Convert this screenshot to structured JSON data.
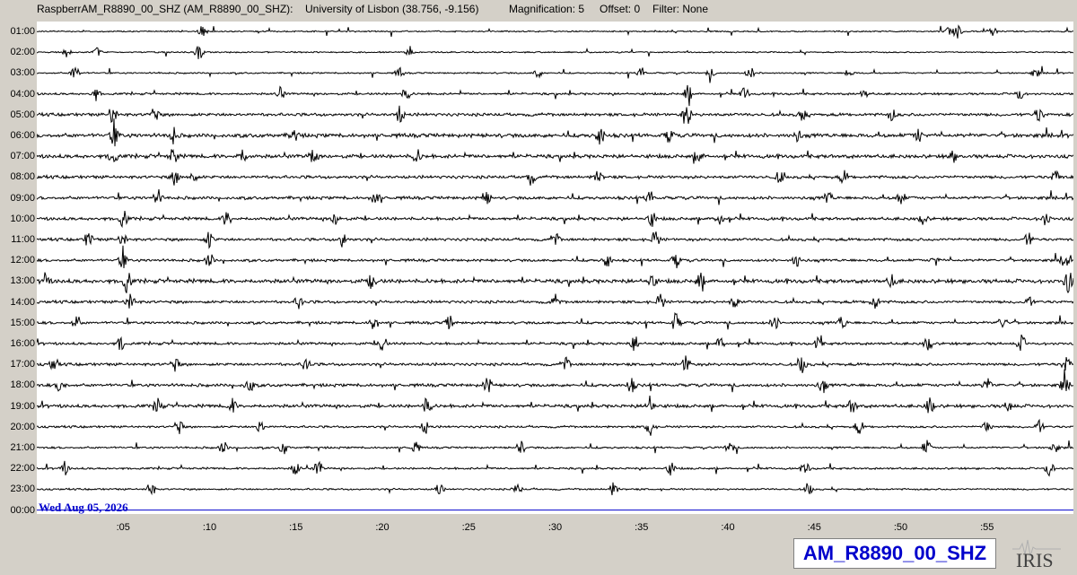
{
  "header": {
    "station": "RaspberrAM_R8890_00_SHZ (AM_R8890_00_SHZ):",
    "location": "University of Lisbon (38.756, -9.156)",
    "magnification": "Magnification: 5",
    "offset": "Offset: 0",
    "filter": "Filter: None"
  },
  "date_label": "Wed Aug 05, 2026",
  "station_box": "AM_R8890_00_SHZ",
  "logo_text": "IRIS",
  "colors": {
    "background": "#d4d0c8",
    "plot_background": "#ffffff",
    "trace": "#000000",
    "date_line": "#0000cc",
    "date_text": "#0000cc",
    "station_text": "#0000cc"
  },
  "chart_data": {
    "type": "line",
    "title": "",
    "xlabel": "",
    "ylabel": "",
    "hours": [
      "01:00",
      "02:00",
      "03:00",
      "04:00",
      "05:00",
      "06:00",
      "07:00",
      "08:00",
      "09:00",
      "10:00",
      "11:00",
      "12:00",
      "13:00",
      "14:00",
      "15:00",
      "16:00",
      "17:00",
      "18:00",
      "19:00",
      "20:00",
      "21:00",
      "22:00",
      "23:00",
      "00:00"
    ],
    "minute_ticks": [
      ":05",
      ":10",
      ":15",
      ":20",
      ":25",
      ":30",
      ":35",
      ":40",
      ":45",
      ":50",
      ":55"
    ],
    "xlim": [
      0,
      60
    ],
    "series_note_amplitude": [
      0.6,
      0.6,
      0.7,
      1.0,
      1.4,
      1.8,
      1.7,
      1.4,
      1.4,
      1.4,
      1.3,
      1.2,
      1.8,
      1.3,
      1.2,
      1.2,
      1.3,
      1.4,
      1.5,
      1.0,
      0.9,
      0.9,
      0.8,
      0
    ],
    "bursts": [
      [
        [
          53.3,
          8
        ],
        [
          55.3,
          6
        ],
        [
          9.6,
          7
        ],
        [
          52.8,
          5
        ]
      ],
      [
        [
          9.4,
          9
        ],
        [
          1.7,
          5
        ],
        [
          3.5,
          5
        ],
        [
          21.6,
          4
        ]
      ],
      [
        [
          2.2,
          10
        ],
        [
          29.0,
          6
        ],
        [
          35.0,
          7
        ],
        [
          41.3,
          8
        ],
        [
          57.8,
          5
        ],
        [
          39.0,
          5
        ],
        [
          21.0,
          6
        ],
        [
          47.0,
          5
        ]
      ],
      [
        [
          3.4,
          8
        ],
        [
          14.1,
          7
        ],
        [
          21.4,
          7
        ],
        [
          37.7,
          10
        ],
        [
          41.0,
          9
        ],
        [
          47.9,
          5
        ],
        [
          56.9,
          7
        ]
      ],
      [
        [
          4.4,
          12
        ],
        [
          6.8,
          9
        ],
        [
          21.0,
          10
        ],
        [
          37.6,
          14
        ],
        [
          44.3,
          9
        ],
        [
          49.5,
          7
        ],
        [
          58.0,
          9
        ]
      ],
      [
        [
          4.5,
          14
        ],
        [
          7.9,
          9
        ],
        [
          14.9,
          8
        ],
        [
          32.6,
          12
        ],
        [
          36.6,
          8
        ],
        [
          44.0,
          7
        ],
        [
          51.0,
          8
        ]
      ],
      [
        [
          4.4,
          10
        ],
        [
          7.9,
          10
        ],
        [
          11.9,
          8
        ],
        [
          16.0,
          9
        ],
        [
          22.0,
          8
        ],
        [
          38.3,
          8
        ],
        [
          53.0,
          7
        ]
      ],
      [
        [
          8.0,
          9
        ],
        [
          9.0,
          8
        ],
        [
          28.6,
          9
        ],
        [
          32.5,
          8
        ],
        [
          43.0,
          7
        ],
        [
          46.7,
          8
        ],
        [
          59.0,
          9
        ]
      ],
      [
        [
          7.0,
          10
        ],
        [
          19.6,
          9
        ],
        [
          26.0,
          9
        ],
        [
          35.5,
          8
        ],
        [
          45.8,
          8
        ],
        [
          50.0,
          9
        ]
      ],
      [
        [
          5.0,
          10
        ],
        [
          11.0,
          9
        ],
        [
          17.3,
          8
        ],
        [
          35.6,
          9
        ],
        [
          39.5,
          8
        ],
        [
          51.3,
          7
        ],
        [
          58.4,
          9
        ]
      ],
      [
        [
          3.0,
          9
        ],
        [
          5.0,
          8
        ],
        [
          10.0,
          11
        ],
        [
          17.7,
          10
        ],
        [
          30.0,
          8
        ],
        [
          35.8,
          10
        ],
        [
          57.4,
          8
        ]
      ],
      [
        [
          5.0,
          11
        ],
        [
          10.0,
          9
        ],
        [
          33.0,
          10
        ],
        [
          37.0,
          9
        ],
        [
          44.0,
          8
        ],
        [
          52.0,
          7
        ],
        [
          59.5,
          9
        ]
      ],
      [
        [
          0.5,
          10
        ],
        [
          5.2,
          13
        ],
        [
          19.4,
          9
        ],
        [
          35.6,
          8
        ],
        [
          38.4,
          9
        ],
        [
          49.5,
          7
        ],
        [
          59.7,
          14
        ]
      ],
      [
        [
          5.4,
          12
        ],
        [
          15.2,
          9
        ],
        [
          30.0,
          8
        ],
        [
          36.1,
          9
        ],
        [
          40.4,
          8
        ],
        [
          48.5,
          8
        ],
        [
          57.4,
          7
        ]
      ],
      [
        [
          2.3,
          9
        ],
        [
          19.5,
          9
        ],
        [
          23.9,
          8
        ],
        [
          37.0,
          12
        ],
        [
          42.7,
          8
        ],
        [
          46.6,
          8
        ],
        [
          55.9,
          9
        ]
      ],
      [
        [
          4.9,
          9
        ],
        [
          20.0,
          10
        ],
        [
          34.6,
          11
        ],
        [
          39.6,
          9
        ],
        [
          45.2,
          8
        ],
        [
          51.6,
          9
        ],
        [
          57.0,
          9
        ]
      ],
      [
        [
          1.0,
          9
        ],
        [
          8.0,
          8
        ],
        [
          15.6,
          10
        ],
        [
          30.6,
          8
        ],
        [
          37.6,
          10
        ],
        [
          44.3,
          10
        ],
        [
          59.6,
          10
        ]
      ],
      [
        [
          1.4,
          10
        ],
        [
          12.3,
          9
        ],
        [
          26.1,
          9
        ],
        [
          34.4,
          9
        ],
        [
          45.5,
          10
        ],
        [
          55.0,
          8
        ],
        [
          59.5,
          10
        ]
      ],
      [
        [
          7.0,
          11
        ],
        [
          11.3,
          9
        ],
        [
          22.6,
          10
        ],
        [
          35.5,
          11
        ],
        [
          47.2,
          9
        ],
        [
          51.7,
          10
        ],
        [
          56.3,
          8
        ]
      ],
      [
        [
          8.2,
          10
        ],
        [
          12.9,
          9
        ],
        [
          22.5,
          8
        ],
        [
          35.5,
          11
        ],
        [
          47.6,
          9
        ],
        [
          55.0,
          8
        ],
        [
          58.0,
          8
        ]
      ],
      [
        [
          10.8,
          8
        ],
        [
          14.3,
          9
        ],
        [
          21.9,
          8
        ],
        [
          28.0,
          8
        ],
        [
          40.1,
          7
        ],
        [
          51.5,
          9
        ],
        [
          58.9,
          7
        ]
      ],
      [
        [
          1.6,
          8
        ],
        [
          15.0,
          9
        ],
        [
          16.3,
          9
        ],
        [
          36.7,
          8
        ],
        [
          44.5,
          7
        ],
        [
          58.6,
          9
        ]
      ],
      [
        [
          6.6,
          9
        ],
        [
          23.3,
          8
        ],
        [
          27.8,
          7
        ],
        [
          33.4,
          9
        ],
        [
          44.7,
          6
        ]
      ],
      []
    ]
  }
}
